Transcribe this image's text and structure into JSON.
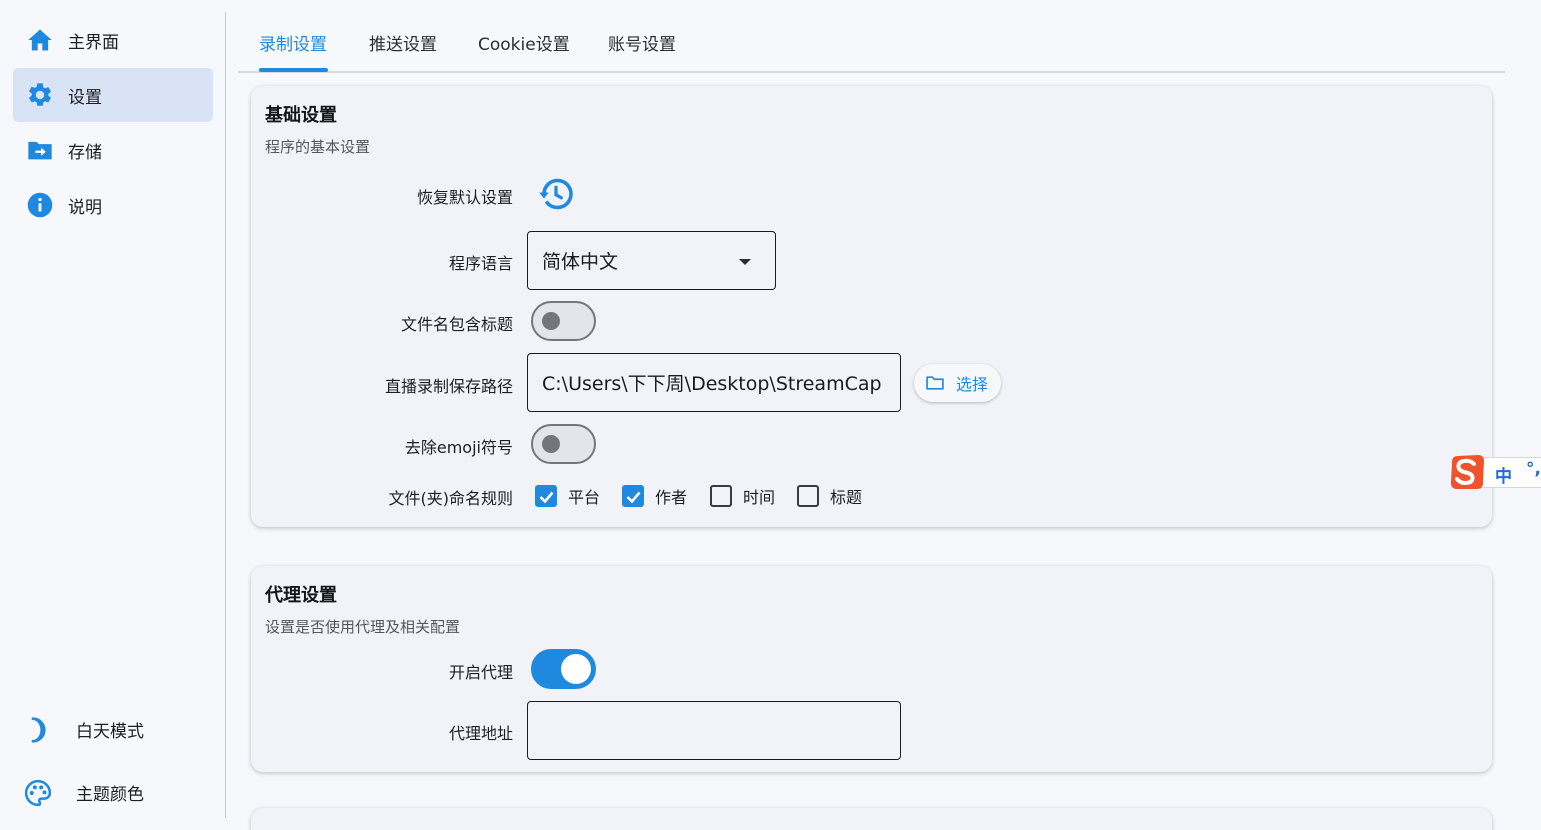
{
  "sidebar": {
    "items": [
      {
        "label": "主界面",
        "icon": "home-icon"
      },
      {
        "label": "设置",
        "icon": "gear-icon"
      },
      {
        "label": "存储",
        "icon": "folder-arrow-icon"
      },
      {
        "label": "说明",
        "icon": "info-icon"
      }
    ],
    "bottom": [
      {
        "label": "白天模式",
        "icon": "moon-icon"
      },
      {
        "label": "主题颜色",
        "icon": "palette-icon"
      }
    ]
  },
  "tabs": [
    {
      "label": "录制设置",
      "active": true
    },
    {
      "label": "推送设置",
      "active": false
    },
    {
      "label": "Cookie设置",
      "active": false
    },
    {
      "label": "账号设置",
      "active": false
    }
  ],
  "basic": {
    "title": "基础设置",
    "subtitle": "程序的基本设置",
    "restore_label": "恢复默认设置",
    "language_label": "程序语言",
    "language_value": "简体中文",
    "filename_title_label": "文件名包含标题",
    "save_path_label": "直播录制保存路径",
    "save_path_value": "C:\\Users\\下下周\\Desktop\\StreamCap",
    "choose_label": "选择",
    "remove_emoji_label": "去除emoji符号",
    "naming_label": "文件(夹)命名规则",
    "naming_options": [
      {
        "label": "平台",
        "checked": true
      },
      {
        "label": "作者",
        "checked": true
      },
      {
        "label": "时间",
        "checked": false
      },
      {
        "label": "标题",
        "checked": false
      }
    ]
  },
  "proxy": {
    "title": "代理设置",
    "subtitle": "设置是否使用代理及相关配置",
    "enable_label": "开启代理",
    "address_label": "代理地址",
    "address_value": ""
  },
  "ime": {
    "mode": "中",
    "punct": "°,"
  },
  "colors": {
    "accent": "#1f89e0",
    "active_nav_bg": "#d8e4f6",
    "card_bg": "#f1f3f8"
  }
}
